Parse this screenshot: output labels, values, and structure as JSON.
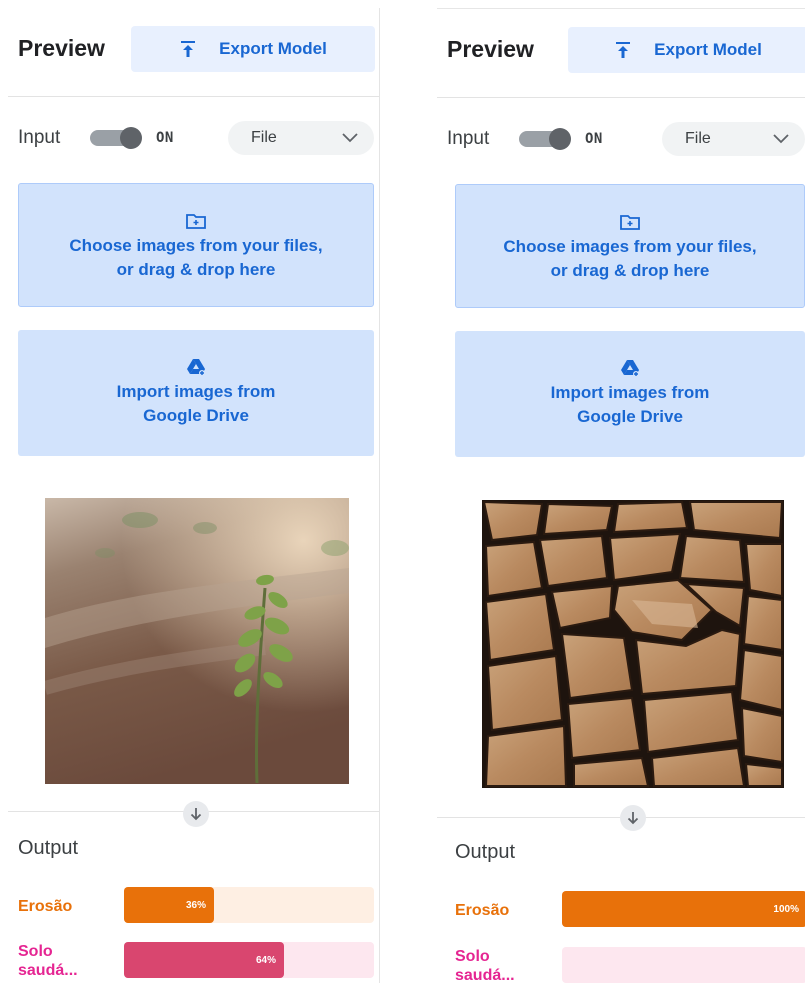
{
  "panels": [
    {
      "title": "Preview",
      "export_label": "Export Model",
      "input_label": "Input",
      "toggle_state": "ON",
      "source_select": "File",
      "upload_text_line1": "Choose images from your files,",
      "upload_text_line2": "or drag & drop here",
      "drive_text_line1": "Import images from",
      "drive_text_line2": "Google Drive",
      "image_subject": "seedling sprouting from soil",
      "output_title": "Output",
      "classes": [
        {
          "label": "Erosão",
          "percent": 36,
          "percent_text": "36%"
        },
        {
          "label_line1": "Solo",
          "label_line2": "saudá...",
          "percent": 64,
          "percent_text": "64%"
        }
      ]
    },
    {
      "title": "Preview",
      "export_label": "Export Model",
      "input_label": "Input",
      "toggle_state": "ON",
      "source_select": "File",
      "upload_text_line1": "Choose images from your files,",
      "upload_text_line2": "or drag & drop here",
      "drive_text_line1": "Import images from",
      "drive_text_line2": "Google Drive",
      "image_subject": "dry cracked earth",
      "output_title": "Output",
      "classes": [
        {
          "label": "Erosão",
          "percent": 100,
          "percent_text": "100%"
        },
        {
          "label_line1": "Solo",
          "label_line2": "saudá...",
          "percent": 0,
          "percent_text": ""
        }
      ]
    }
  ],
  "colors": {
    "accent_blue": "#1967d2",
    "erosao_orange": "#e8710a",
    "solo_pink": "#d9466f"
  },
  "icons": [
    "export-icon",
    "chevron-down-icon",
    "folder-add-icon",
    "google-drive-icon",
    "arrow-down-icon"
  ]
}
